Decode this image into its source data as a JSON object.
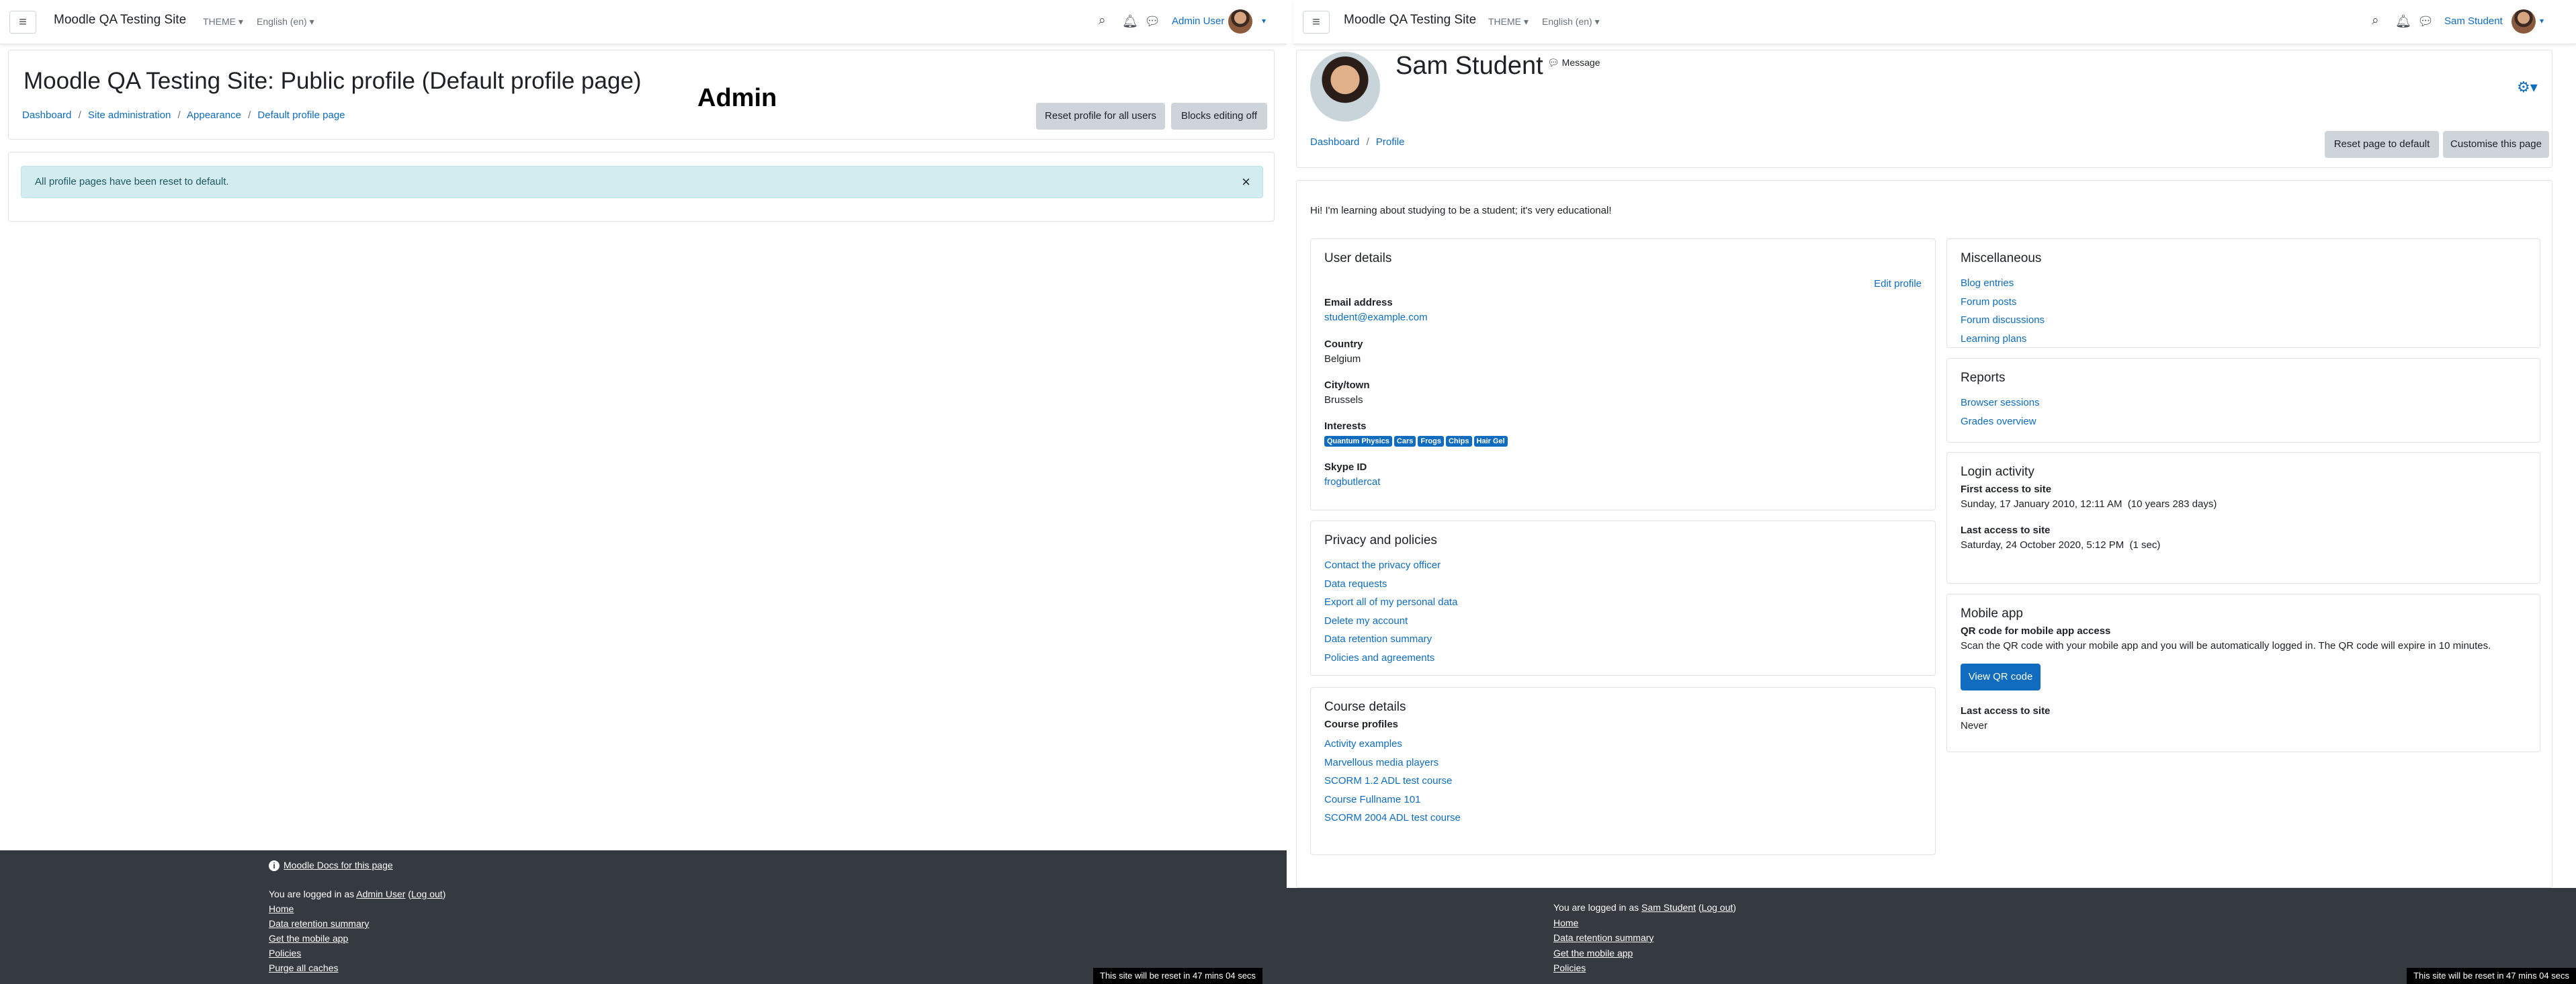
{
  "left": {
    "navbar": {
      "brand": "Moodle QA Testing Site",
      "theme_menu": "THEME",
      "language_menu": "English (en)",
      "user_name": "Admin User"
    },
    "header": {
      "title": "Moodle QA Testing Site: Public profile (Default profile page)",
      "breadcrumb": [
        "Dashboard",
        "Site administration",
        "Appearance",
        "Default profile page"
      ],
      "reset_button": "Reset profile for all users",
      "editing_button": "Blocks editing off"
    },
    "overlay_label": "Admin",
    "alert": {
      "message": "All profile pages have been reset to default.",
      "close": "×"
    },
    "footer": {
      "docs_link": "Moodle Docs for this page",
      "logged_in_prefix": "You are logged in as",
      "user_link": "Admin User",
      "logout_link": "Log out",
      "links": [
        "Home",
        "Data retention summary",
        "Get the mobile app",
        "Policies",
        "Purge all caches"
      ],
      "reset_notice": "This site will be reset in 47 mins 04 secs"
    }
  },
  "right": {
    "navbar": {
      "brand": "Moodle QA Testing Site",
      "theme_menu": "THEME",
      "language_menu": "English (en)",
      "user_name": "Sam Student"
    },
    "header": {
      "name": "Sam Student",
      "message_label": "Message",
      "breadcrumb": [
        "Dashboard",
        "Profile"
      ],
      "reset_button": "Reset page to default",
      "customise_button": "Customise this page"
    },
    "description": "Hi! I'm learning about studying to be a student; it's very educational!",
    "user_details": {
      "title": "User details",
      "edit_link": "Edit profile",
      "email_label": "Email address",
      "email_value": "student@example.com",
      "country_label": "Country",
      "country_value": "Belgium",
      "city_label": "City/town",
      "city_value": "Brussels",
      "interests_label": "Interests",
      "interests": [
        "Quantum Physics",
        "Cars",
        "Frogs",
        "Chips",
        "Hair Gel"
      ],
      "skype_label": "Skype ID",
      "skype_value": "frogbutlercat"
    },
    "privacy": {
      "title": "Privacy and policies",
      "links": [
        "Contact the privacy officer",
        "Data requests",
        "Export all of my personal data",
        "Delete my account",
        "Data retention summary",
        "Policies and agreements"
      ]
    },
    "course_details": {
      "title": "Course details",
      "label": "Course profiles",
      "links": [
        "Activity examples",
        "Marvellous media players",
        "SCORM 1.2 ADL test course",
        "Course Fullname 101",
        "SCORM 2004 ADL test course"
      ]
    },
    "miscellaneous": {
      "title": "Miscellaneous",
      "links": [
        "Blog entries",
        "Forum posts",
        "Forum discussions",
        "Learning plans"
      ]
    },
    "reports": {
      "title": "Reports",
      "links": [
        "Browser sessions",
        "Grades overview"
      ]
    },
    "login_activity": {
      "title": "Login activity",
      "first_label": "First access to site",
      "first_value": "Sunday, 17 January 2010, 12:11 AM  (10 years 283 days)",
      "last_label": "Last access to site",
      "last_value": "Saturday, 24 October 2020, 5:12 PM  (1 sec)"
    },
    "mobile_app": {
      "title": "Mobile app",
      "qr_label": "QR code for mobile app access",
      "qr_text": "Scan the QR code with your mobile app and you will be automatically logged in. The QR code will expire in 10 minutes.",
      "qr_button": "View QR code",
      "last_label": "Last access to site",
      "last_value": "Never"
    },
    "footer": {
      "logged_in_prefix": "You are logged in as",
      "user_link": "Sam Student",
      "logout_link": "Log out",
      "links": [
        "Home",
        "Data retention summary",
        "Get the mobile app",
        "Policies"
      ],
      "reset_notice": "This site will be reset in 47 mins 04 secs"
    }
  },
  "colors": {
    "link": "#0f6cbf",
    "footer_bg": "#343a40",
    "alert_bg": "#d2ecf0",
    "secondary_btn": "#ced4da"
  }
}
